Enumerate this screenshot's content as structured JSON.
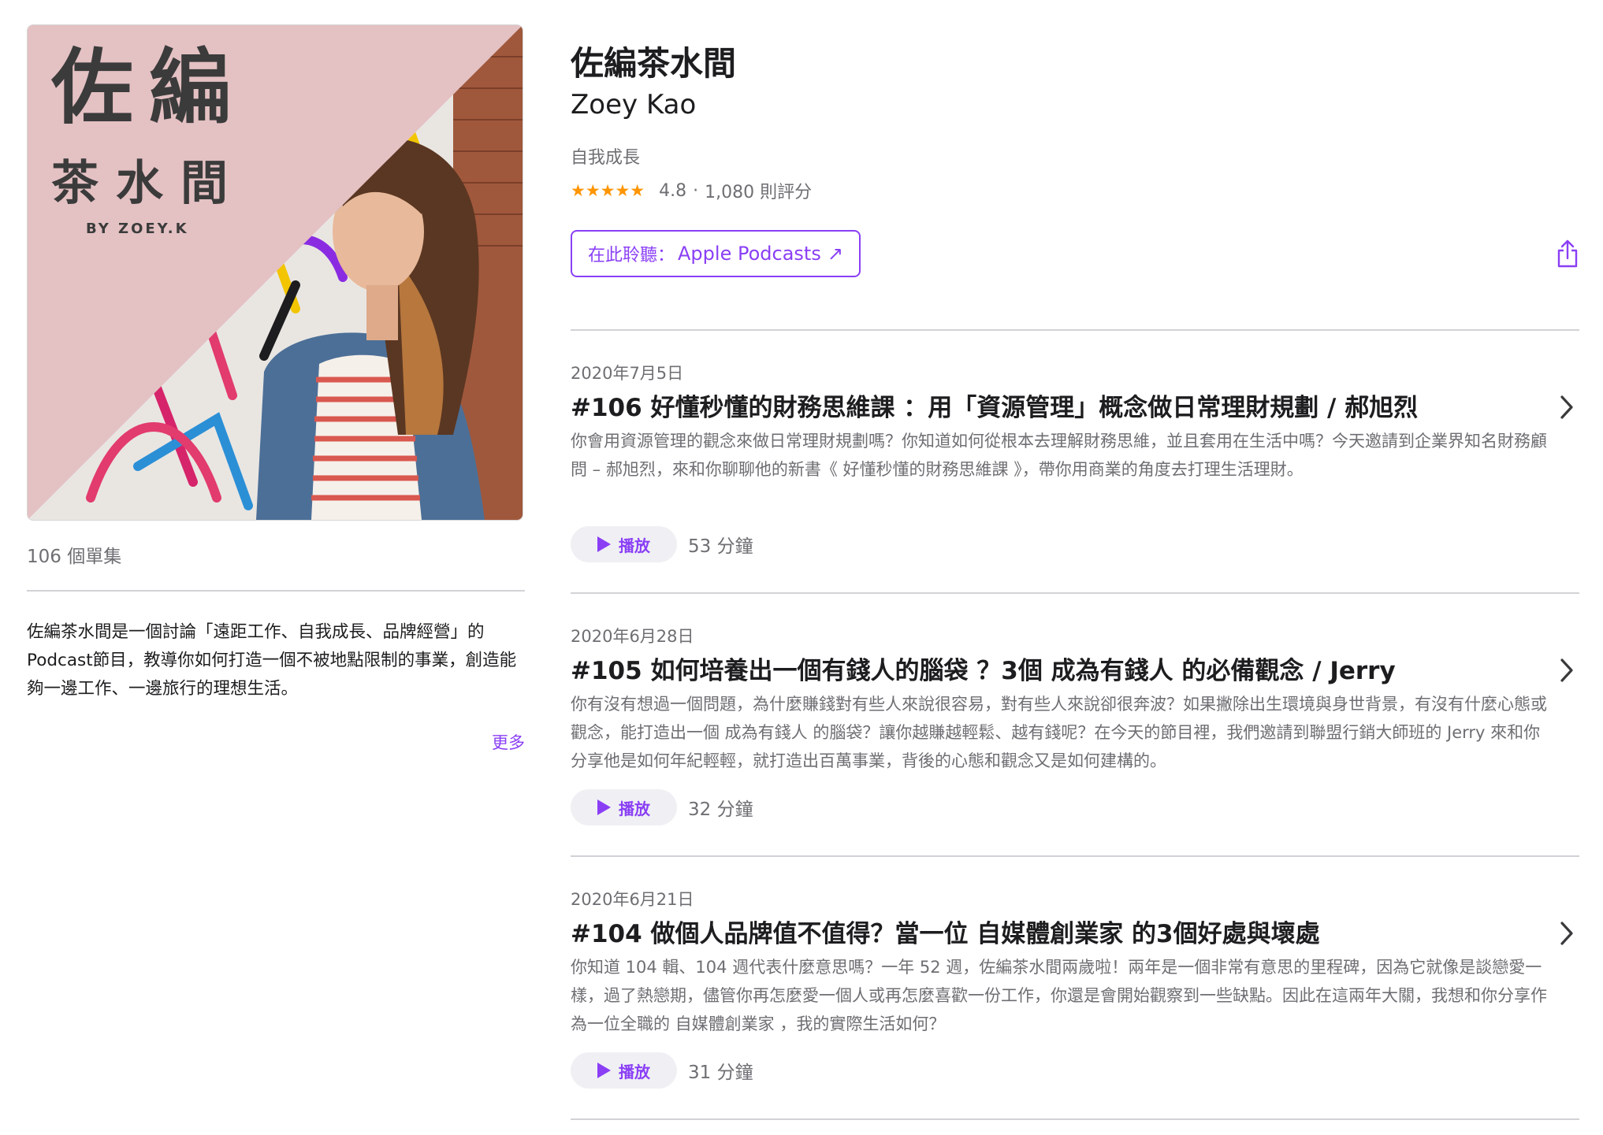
{
  "podcast": {
    "title": "佐編茶水間",
    "author": "Zoey Kao",
    "category": "自我成長",
    "stars": "★★★★★",
    "rating": "4.8",
    "rating_sep": "·",
    "rating_count": "1,080 則評分",
    "episode_count": "106 個單集",
    "description": "佐編茶水間是一個討論「遠距工作、自我成長、品牌經營」的 Podcast節目，教導你如何打造一個不被地點限制的事業，創造能夠一邊工作、一邊旅行的理想生活。",
    "more_label": "更多"
  },
  "artwork": {
    "title_line1": "佐編",
    "title_line2": "茶水間",
    "byline": "BY ZOEY.K"
  },
  "listen": {
    "prefix": "在此聆聽：",
    "brand": "Apple Podcasts",
    "arrow": "↗"
  },
  "episodes": [
    {
      "date": "2020年7月5日",
      "title": "#106 好懂秒懂的財務思維課 ：用「資源管理」概念做日常理財規劃 / 郝旭烈",
      "summary": "你會用資源管理的觀念來做日常理財規劃嗎？你知道如何從根本去理解財務思維，並且套用在生活中嗎？今天邀請到企業界知名財務顧問 – 郝旭烈，來和你聊聊他的新書《 好懂秒懂的財務思維課 》，帶你用商業的角度去打理生活理財。",
      "play_label": "播放",
      "duration": "53 分鐘"
    },
    {
      "date": "2020年6月28日",
      "title": "#105 如何培養出一個有錢人的腦袋 ？3個 成為有錢人 的必備觀念 / Jerry",
      "summary": "你有沒有想過一個問題，為什麼賺錢對有些人來說很容易，對有些人來說卻很奔波？如果撇除出生環境與身世背景，有沒有什麼心態或觀念，能打造出一個 成為有錢人 的腦袋？讓你越賺越輕鬆、越有錢呢？在今天的節目裡，我們邀請到聯盟行銷大師班的 Jerry 來和你分享他是如何年紀輕輕，就打造出百萬事業，背後的心態和觀念又是如何建構的。",
      "play_label": "播放",
      "duration": "32 分鐘"
    },
    {
      "date": "2020年6月21日",
      "title": "#104 做個人品牌值不值得？當一位 自媒體創業家 的3個好處與壞處",
      "summary": "你知道 104 輯、104 週代表什麼意思嗎？一年 52 週，佐編茶水間兩歲啦！兩年是一個非常有意思的里程碑，因為它就像是談戀愛一樣，過了熱戀期，儘管你再怎麼愛一個人或再怎麼喜歡一份工作，你還是會開始觀察到一些缺點。因此在這兩年大關，我想和你分享作為一位全職的 自媒體創業家 ，我的實際生活如何？",
      "play_label": "播放",
      "duration": "31 分鐘"
    }
  ],
  "colors": {
    "accent": "#8a3ff5",
    "star": "#ff9500",
    "secondary_text": "#6e6e73",
    "artwork_pink": "#e4c1c3"
  },
  "icons": {
    "share": "share-icon",
    "chevron": "chevron-right-icon",
    "play": "play-icon"
  }
}
